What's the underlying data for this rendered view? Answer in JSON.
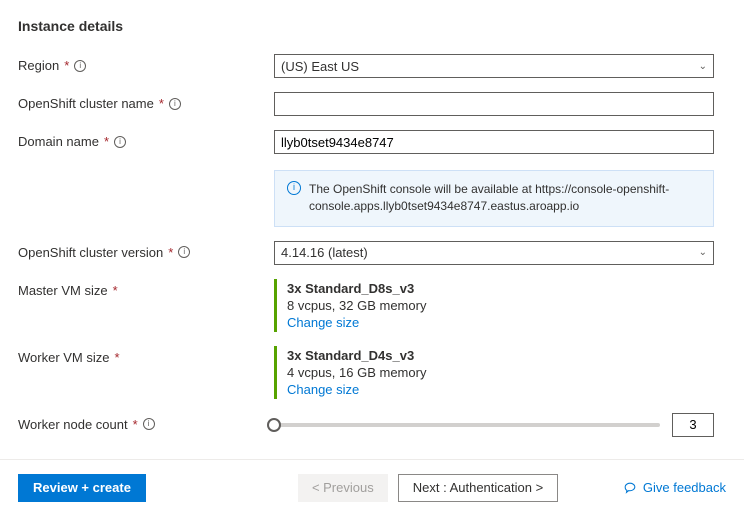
{
  "section_title": "Instance details",
  "labels": {
    "region": "Region",
    "cluster_name": "OpenShift cluster name",
    "domain_name": "Domain name",
    "cluster_version": "OpenShift cluster version",
    "master_vm": "Master VM size",
    "worker_vm": "Worker VM size",
    "worker_count": "Worker node count"
  },
  "region": {
    "value": "(US) East US"
  },
  "cluster_name": {
    "value": ""
  },
  "domain_name": {
    "value": "llyb0tset9434e8747"
  },
  "info_callout": "The OpenShift console will be available at https://console-openshift-console.apps.llyb0tset9434e8747.eastus.aroapp.io",
  "cluster_version": {
    "value": "4.14.16 (latest)"
  },
  "master_vm": {
    "title": "3x Standard_D8s_v3",
    "spec": "8 vcpus, 32 GB memory",
    "change": "Change size"
  },
  "worker_vm": {
    "title": "3x Standard_D4s_v3",
    "spec": "4 vcpus, 16 GB memory",
    "change": "Change size"
  },
  "worker_count": {
    "value": "3"
  },
  "footer": {
    "review": "Review + create",
    "prev": "< Previous",
    "next": "Next : Authentication >",
    "feedback": "Give feedback"
  }
}
